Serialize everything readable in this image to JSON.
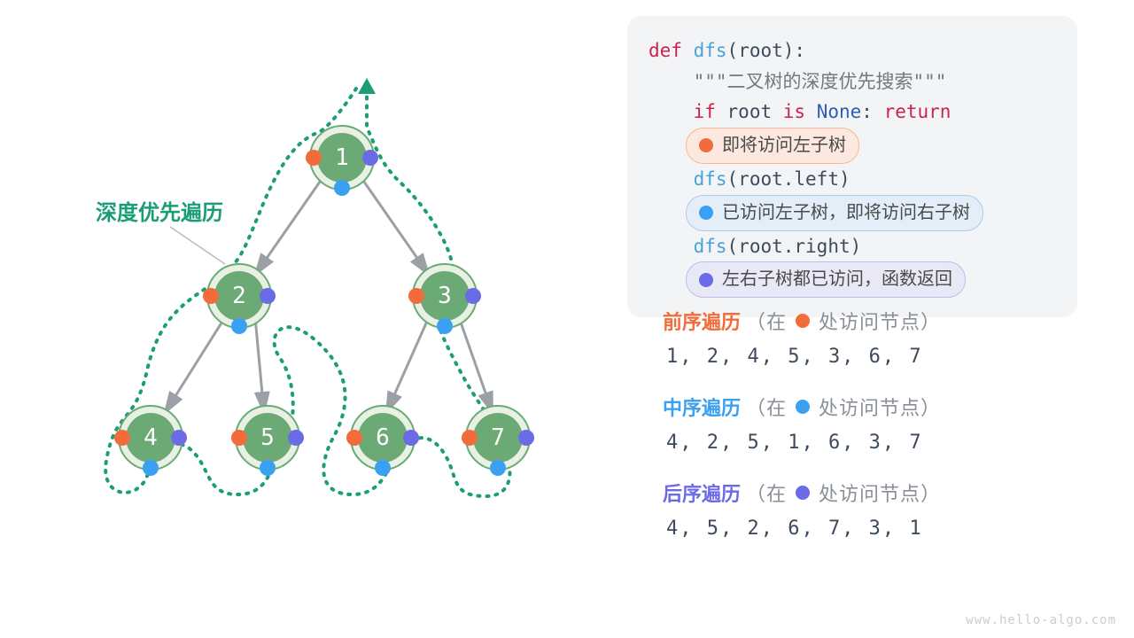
{
  "tree_label": "深度优先遍历",
  "nodes": [
    "1",
    "2",
    "3",
    "4",
    "5",
    "6",
    "7"
  ],
  "code": {
    "def": "def",
    "fn": "dfs",
    "param": "root",
    "docstring": "\"\"\"二叉树的深度优先搜索\"\"\"",
    "if_line_kw_if": "if",
    "if_line_kw_is": "is",
    "if_line_none": "None",
    "if_line_return": "return",
    "badge_orange": "即将访问左子树",
    "call_left_a": "dfs(root",
    "call_left_b": ".left)",
    "badge_blue": "已访问左子树，即将访问右子树",
    "call_right_a": "dfs(root",
    "call_right_b": ".right)",
    "badge_purple": "左右子树都已访问，函数返回"
  },
  "orders": {
    "pre_title": "前序遍历",
    "pre_note_a": "（在",
    "pre_note_b": "处访问节点）",
    "pre_seq": "1, 2, 4, 5, 3, 6, 7",
    "in_title": "中序遍历",
    "in_seq": "4, 2, 5, 1, 6, 3, 7",
    "post_title": "后序遍历",
    "post_seq": "4, 5, 2, 6, 7, 3, 1"
  },
  "watermark": "www.hello-algo.com",
  "colors": {
    "orange": "#f26b3a",
    "blue": "#3aa0f2",
    "purple": "#6b6be6",
    "green": "#6baa75",
    "teal": "#1b9e77"
  }
}
